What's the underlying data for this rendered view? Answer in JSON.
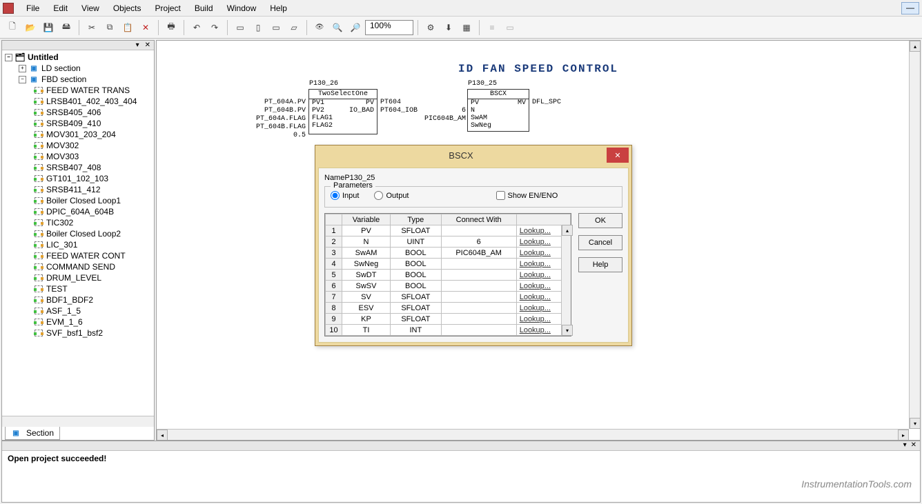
{
  "menu": {
    "items": [
      "File",
      "Edit",
      "View",
      "Objects",
      "Project",
      "Build",
      "Window",
      "Help"
    ]
  },
  "zoom": "100%",
  "tree": {
    "root": "Untitled",
    "sections": [
      {
        "name": "LD section",
        "expanded": false,
        "items": []
      },
      {
        "name": "FBD section",
        "expanded": true,
        "items": [
          "FEED WATER TRANS",
          "LRSB401_402_403_404",
          "SRSB405_406",
          "SRSB409_410",
          "MOV301_203_204",
          "MOV302",
          "MOV303",
          "SRSB407_408",
          "GT101_102_103",
          "SRSB411_412",
          "Boiler Closed Loop1",
          "DPIC_604A_604B",
          "TIC302",
          "Boiler Closed Loop2",
          "LIC_301",
          "FEED WATER CONT",
          "COMMAND SEND",
          "DRUM_LEVEL",
          "TEST",
          "BDF1_BDF2",
          "ASF_1_5",
          "EVM_1_6",
          "SVF_bsf1_bsf2"
        ]
      }
    ]
  },
  "sidebar_tab": "Section",
  "canvas": {
    "title": "ID FAN SPEED CONTROL",
    "block1": {
      "name": "P130_26",
      "type": "TwoSelectOne",
      "left_ports": [
        "PV1",
        "PV2",
        "FLAG1",
        "FLAG2"
      ],
      "right_ports": [
        "PV",
        "IO_BAD"
      ],
      "left_ext": [
        "PT_604A.PV",
        "PT_604B.PV",
        "PT_604A.FLAG",
        "PT_604B.FLAG",
        "0.5"
      ],
      "right_ext": [
        "PT604",
        "PT604_IOB"
      ]
    },
    "block2": {
      "name": "P130_25",
      "type": "BSCX",
      "left_ports": [
        "PV",
        "N",
        "SwAM",
        "SwNeg"
      ],
      "right_ports": [
        "MV"
      ],
      "left_ext": [
        "",
        "6",
        "PIC604B_AM",
        ""
      ],
      "right_ext": [
        "DFL_SPC"
      ]
    }
  },
  "dialog": {
    "title": "BSCX",
    "name_label": "NameP130_25",
    "fieldset": "Parameters",
    "radio_input": "Input",
    "radio_output": "Output",
    "chk_eno": "Show EN/ENO",
    "columns": [
      "Variable",
      "Type",
      "Connect With",
      ""
    ],
    "rows": [
      {
        "n": "1",
        "var": "PV",
        "type": "SFLOAT",
        "conn": "",
        "lk": "Lookup..."
      },
      {
        "n": "2",
        "var": "N",
        "type": "UINT",
        "conn": "6",
        "lk": "Lookup..."
      },
      {
        "n": "3",
        "var": "SwAM",
        "type": "BOOL",
        "conn": "PIC604B_AM",
        "lk": "Lookup..."
      },
      {
        "n": "4",
        "var": "SwNeg",
        "type": "BOOL",
        "conn": "",
        "lk": "Lookup..."
      },
      {
        "n": "5",
        "var": "SwDT",
        "type": "BOOL",
        "conn": "",
        "lk": "Lookup..."
      },
      {
        "n": "6",
        "var": "SwSV",
        "type": "BOOL",
        "conn": "",
        "lk": "Lookup..."
      },
      {
        "n": "7",
        "var": "SV",
        "type": "SFLOAT",
        "conn": "",
        "lk": "Lookup..."
      },
      {
        "n": "8",
        "var": "ESV",
        "type": "SFLOAT",
        "conn": "",
        "lk": "Lookup..."
      },
      {
        "n": "9",
        "var": "KP",
        "type": "SFLOAT",
        "conn": "",
        "lk": "Lookup..."
      },
      {
        "n": "10",
        "var": "TI",
        "type": "INT",
        "conn": "",
        "lk": "Lookup..."
      }
    ],
    "btn_ok": "OK",
    "btn_cancel": "Cancel",
    "btn_help": "Help"
  },
  "output": "Open project succeeded!",
  "watermark": "InstrumentationTools.com"
}
